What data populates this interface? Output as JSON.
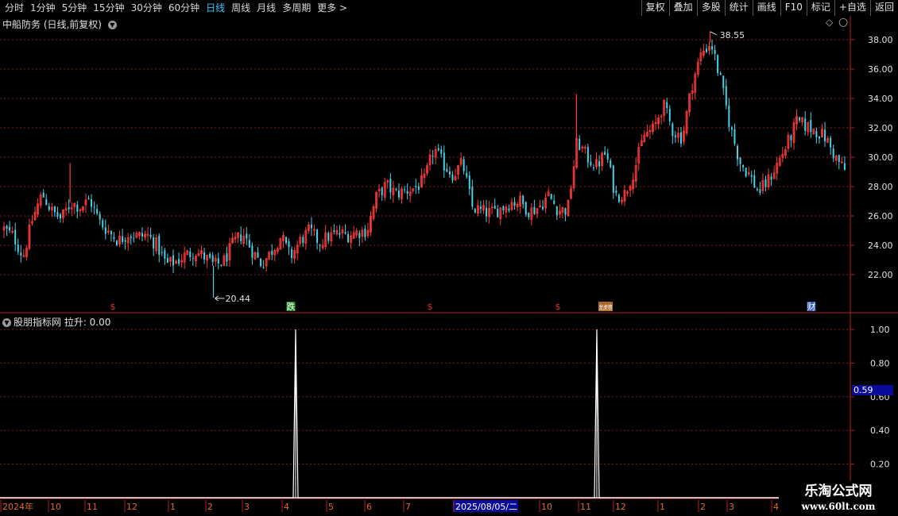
{
  "toolbar": {
    "periods": [
      "分时",
      "1分钟",
      "5分钟",
      "15分钟",
      "30分钟",
      "60分钟",
      "日线",
      "周线",
      "月线",
      "多周期",
      "更多 >"
    ],
    "active_period": "日线",
    "tools": [
      "复权",
      "叠加",
      "多股",
      "统计",
      "画线",
      "F10",
      "标记",
      "+自选",
      "返回"
    ]
  },
  "main_panel": {
    "title": "中船防务 (日线,前复权)",
    "high_label": "38.55",
    "low_label": "20.44",
    "event_markers": [
      {
        "text": "$",
        "color": "#e03030"
      },
      {
        "text": "跌",
        "color": "#2aa02a"
      },
      {
        "text": "$",
        "color": "#e03030"
      },
      {
        "text": "$",
        "color": "#e03030"
      },
      {
        "text": "龙虎榜",
        "color": "#c87830"
      },
      {
        "text": "财",
        "color": "#3a6ad0"
      }
    ]
  },
  "indicator_panel": {
    "title": "股朋指标网 拉升: 0.00",
    "current_value": "0.59"
  },
  "chart_data": [
    {
      "type": "candlestick",
      "title": "中船防务 (日线,前复权)",
      "ylim": [
        20,
        40
      ],
      "y_ticks": [
        "22.00",
        "24.00",
        "26.00",
        "28.00",
        "30.00",
        "32.00",
        "34.00",
        "36.00",
        "38.00"
      ],
      "annotations": [
        {
          "label": "38.55",
          "value": 38.55,
          "kind": "high"
        },
        {
          "label": "20.44",
          "value": 20.44,
          "kind": "low"
        }
      ],
      "close_path": [
        25.1,
        24.6,
        23.2,
        25.8,
        27.5,
        26.3,
        25.8,
        26.9,
        26.6,
        27.1,
        25.6,
        24.9,
        24.3,
        24.8,
        24.6,
        24.7,
        24.0,
        22.7,
        22.9,
        23.3,
        23.6,
        23.2,
        22.6,
        22.9,
        24.1,
        24.8,
        23.6,
        22.7,
        23.6,
        24.6,
        23.2,
        24.3,
        25.0,
        24.2,
        24.6,
        24.8,
        24.7,
        24.9,
        25.0,
        27.3,
        28.1,
        27.5,
        27.7,
        27.9,
        28.4,
        30.6,
        29.5,
        28.8,
        29.6,
        26.6,
        26.3,
        26.2,
        26.5,
        26.9,
        27.0,
        26.3,
        26.6,
        27.4,
        26.4,
        26.4,
        31.1,
        30.0,
        29.4,
        30.3,
        27.4,
        27.5,
        29.2,
        31.5,
        31.9,
        33.6,
        31.8,
        31.3,
        34.9,
        37.1,
        37.8,
        35.2,
        32.1,
        29.7,
        28.8,
        27.6,
        28.4,
        29.6,
        30.9,
        32.4,
        32.1,
        31.8,
        31.3,
        30.0,
        29.1
      ],
      "spikes": [
        {
          "index": 7,
          "value": 29.6
        },
        {
          "index": 22,
          "value": 20.44
        },
        {
          "index": 60,
          "value": 34.3
        },
        {
          "index": 74,
          "value": 38.55
        }
      ]
    },
    {
      "type": "line",
      "title": "股朋指标网 拉升",
      "ylim": [
        0,
        1.05
      ],
      "y_ticks": [
        "0.20",
        "0.40",
        "0.60",
        "0.80",
        "1.00"
      ],
      "series": [
        {
          "name": "拉升",
          "spikes": [
            {
              "date_label": "4",
              "value": 1.0
            },
            {
              "date_label": "11",
              "value": 1.0
            }
          ]
        }
      ],
      "current_value": 0.59
    }
  ],
  "date_axis": {
    "labels": [
      "2024年",
      "10",
      "11",
      "12",
      "1",
      "2",
      "3",
      "4",
      "5",
      "6",
      "7",
      "2025/08/05/二",
      "10",
      "11",
      "12",
      "1",
      "2",
      "3",
      "4"
    ],
    "highlighted": "2025/08/05/二"
  },
  "watermark": {
    "line1": "乐淘公式网",
    "line2": "www.60lt.com"
  }
}
